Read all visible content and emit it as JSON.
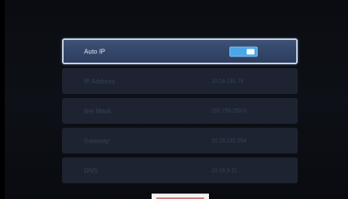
{
  "network_settings": {
    "rows": [
      {
        "label": "Auto IP",
        "value": "",
        "toggle_on": true
      },
      {
        "label": "IP Address",
        "value": "10.16.131.74"
      },
      {
        "label": "Net Mask",
        "value": "255.255.255.0"
      },
      {
        "label": "Gateway",
        "value": "10.16.131.254"
      },
      {
        "label": "DNS",
        "value": "10.16.3.11"
      }
    ]
  },
  "colors": {
    "selected_row": "#3a4e70",
    "row": "#1d2331",
    "toggle_on": "#4aa6e6",
    "background": "#0b0d12"
  }
}
